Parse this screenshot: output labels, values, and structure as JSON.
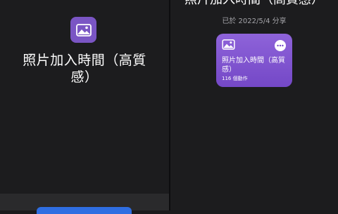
{
  "left": {
    "icon": "photo-icon",
    "title": "照片加入時間（高質感）"
  },
  "right": {
    "title": "照片加入時間（高質感）",
    "shared_date": "已於 2022/5/4 分享",
    "card": {
      "icon": "photo-icon",
      "title": "照片加入時間（高質感）",
      "count": "116 個動作",
      "more_icon": "ellipsis-icon"
    }
  },
  "colors": {
    "background": "#1c1c1e",
    "accent_purple": "#7a55c4",
    "button_blue": "#2f6ee2"
  }
}
